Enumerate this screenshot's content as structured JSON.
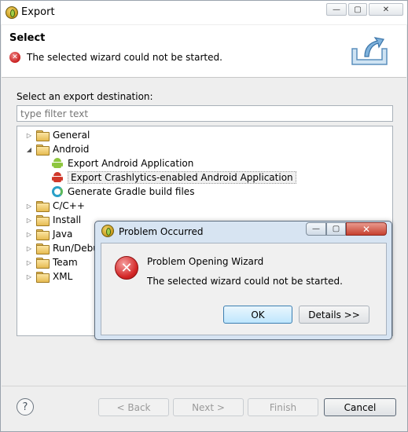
{
  "window": {
    "title": "Export",
    "controls": {
      "minimize": "—",
      "maximize": "▢",
      "close": "✕"
    }
  },
  "header": {
    "title": "Select",
    "message": "The selected wizard could not be started."
  },
  "destination": {
    "label": "Select an export destination:",
    "filter_placeholder": "type filter text",
    "filter_value": ""
  },
  "tree": {
    "general": "General",
    "android": "Android",
    "android_children": [
      "Export Android Application",
      "Export Crashlytics-enabled Android Application",
      "Generate Gradle build files"
    ],
    "cpp": "C/C++",
    "install": "Install",
    "java": "Java",
    "rundebug": "Run/Debug",
    "team": "Team",
    "xml": "XML"
  },
  "buttons": {
    "help": "?",
    "back": "< Back",
    "next": "Next >",
    "finish": "Finish",
    "cancel": "Cancel"
  },
  "dialog": {
    "title": "Problem Occurred",
    "heading": "Problem Opening Wizard",
    "message": "The selected wizard could not be started.",
    "ok": "OK",
    "details": "Details >>",
    "controls": {
      "minimize": "—",
      "maximize": "▢",
      "close": "✕"
    }
  },
  "colors": {
    "android_green": "#8ec63f",
    "android_red": "#d0382a",
    "error_red": "#d32626"
  }
}
